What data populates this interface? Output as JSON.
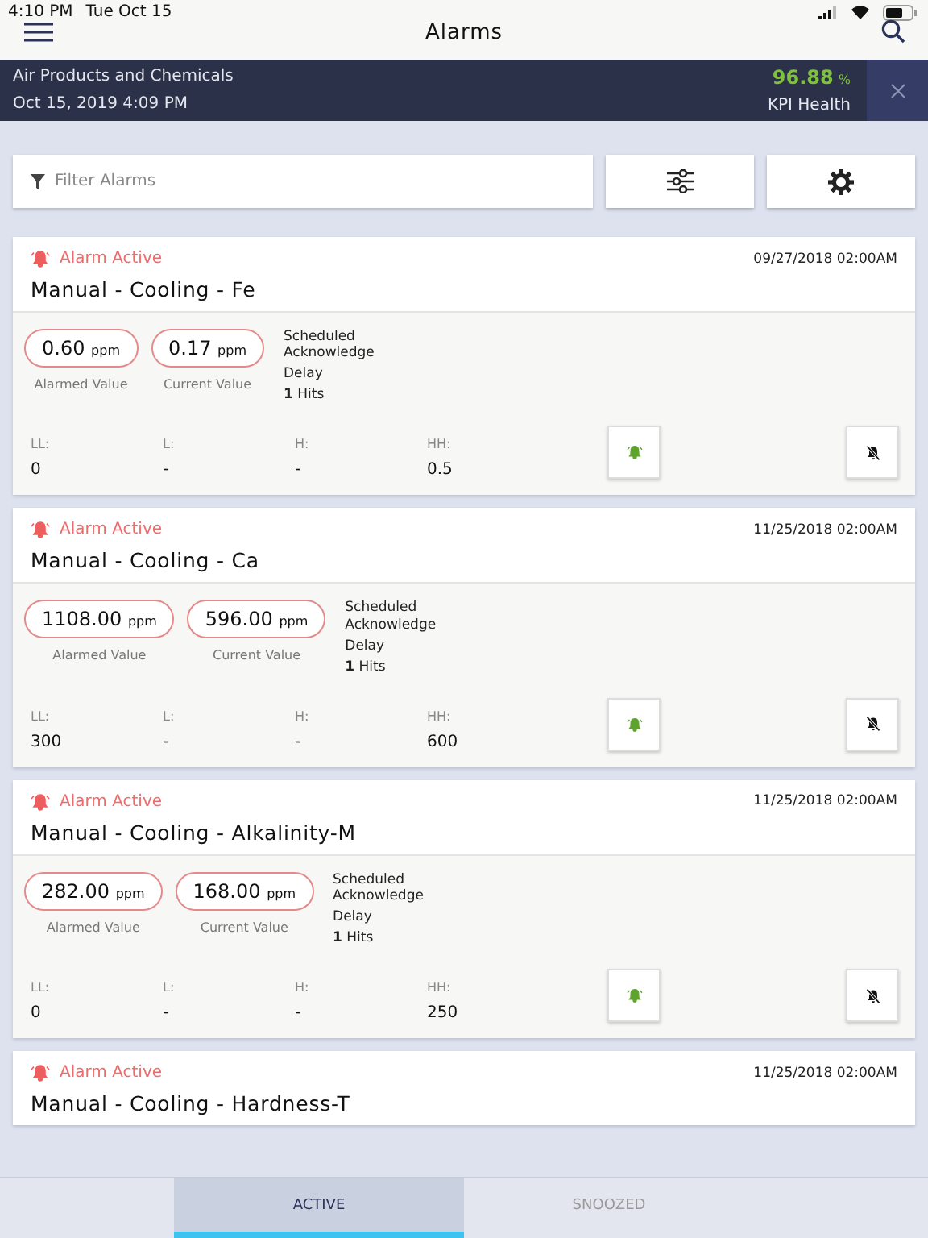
{
  "status_bar": {
    "time": "4:10 PM",
    "date": "Tue Oct 15"
  },
  "nav": {
    "title": "Alarms"
  },
  "banner": {
    "company": "Air Products and Chemicals",
    "timestamp": "Oct 15, 2019 4:09 PM",
    "kpi_value": "96.88",
    "kpi_unit": "%",
    "kpi_label": "KPI Health"
  },
  "filter": {
    "placeholder": "Filter Alarms"
  },
  "alarms": [
    {
      "status": "Alarm Active",
      "time": "09/27/2018 02:00AM",
      "name": "Manual - Cooling - Fe",
      "alarmed": "0.60",
      "alarmed_unit": "ppm",
      "current": "0.17",
      "current_unit": "ppm",
      "alarmed_label": "Alarmed Value",
      "current_label": "Current Value",
      "schedule": "Scheduled Acknowledge",
      "delay": "Delay",
      "hits_count": "1",
      "hits_label": "Hits",
      "limits": [
        {
          "label": "LL:",
          "value": "0"
        },
        {
          "label": "L:",
          "value": "-"
        },
        {
          "label": "H:",
          "value": "-"
        },
        {
          "label": "HH:",
          "value": "0.5"
        }
      ]
    },
    {
      "status": "Alarm Active",
      "time": "11/25/2018 02:00AM",
      "name": "Manual - Cooling - Ca",
      "alarmed": "1108.00",
      "alarmed_unit": "ppm",
      "current": "596.00",
      "current_unit": "ppm",
      "alarmed_label": "Alarmed Value",
      "current_label": "Current Value",
      "schedule": "Scheduled Acknowledge",
      "delay": "Delay",
      "hits_count": "1",
      "hits_label": "Hits",
      "limits": [
        {
          "label": "LL:",
          "value": "300"
        },
        {
          "label": "L:",
          "value": "-"
        },
        {
          "label": "H:",
          "value": "-"
        },
        {
          "label": "HH:",
          "value": "600"
        }
      ]
    },
    {
      "status": "Alarm Active",
      "time": "11/25/2018 02:00AM",
      "name": "Manual - Cooling - Alkalinity-M",
      "alarmed": "282.00",
      "alarmed_unit": "ppm",
      "current": "168.00",
      "current_unit": "ppm",
      "alarmed_label": "Alarmed Value",
      "current_label": "Current Value",
      "schedule": "Scheduled Acknowledge",
      "delay": "Delay",
      "hits_count": "1",
      "hits_label": "Hits",
      "limits": [
        {
          "label": "LL:",
          "value": "0"
        },
        {
          "label": "L:",
          "value": "-"
        },
        {
          "label": "H:",
          "value": "-"
        },
        {
          "label": "HH:",
          "value": "250"
        }
      ]
    },
    {
      "status": "Alarm Active",
      "time": "11/25/2018 02:00AM",
      "name": "Manual - Cooling - Hardness-T"
    }
  ],
  "tabs": [
    {
      "label": "ACTIVE",
      "selected": true
    },
    {
      "label": "SNOOZED",
      "selected": false
    }
  ]
}
